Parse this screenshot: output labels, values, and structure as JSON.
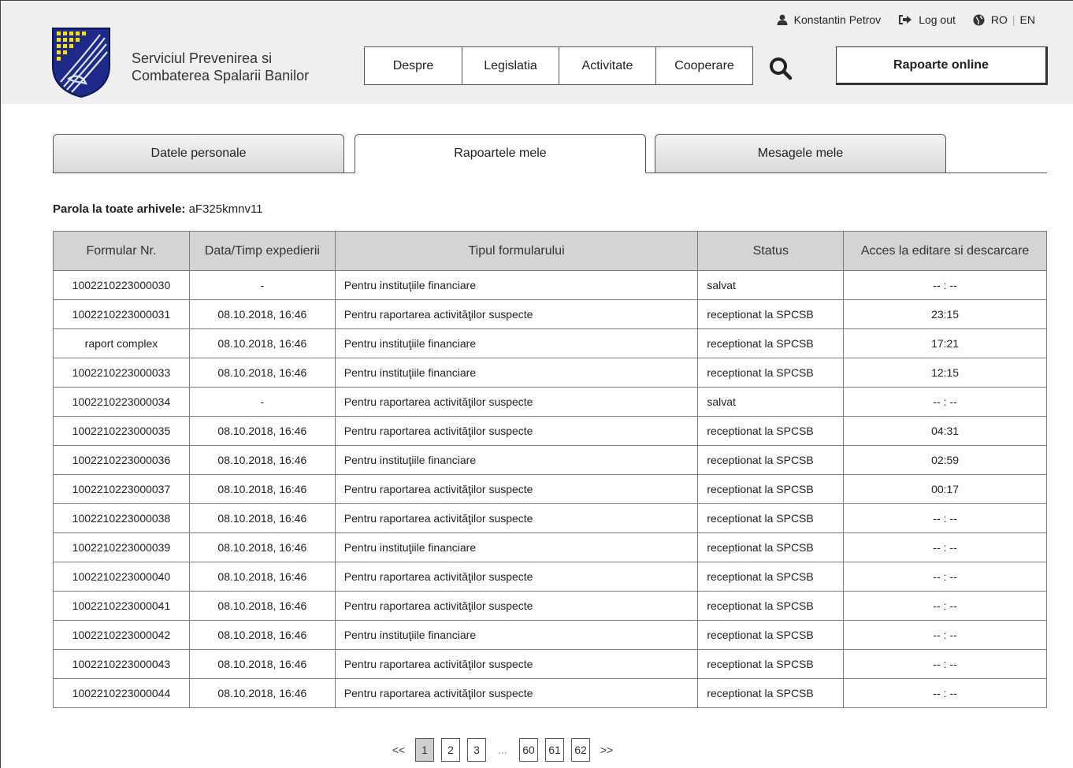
{
  "header": {
    "org_line1": "Serviciul Prevenirea si",
    "org_line2": "Combaterea Spalarii Banilor",
    "user_name": "Konstantin Petrov",
    "logout_label": "Log out",
    "lang_ro": "RO",
    "lang_sep": "|",
    "lang_en": "EN",
    "nav": [
      "Despre",
      "Legislatia",
      "Activitate",
      "Cooperare"
    ],
    "rapoarte_label": "Rapoarte online",
    "icons": {
      "user": "user-icon",
      "logout": "logout-icon",
      "globe": "globe-icon",
      "search": "search-icon"
    }
  },
  "tabs": [
    "Datele personale",
    "Rapoartele mele",
    "Mesagele mele"
  ],
  "active_tab": 1,
  "password": {
    "label": "Parola la toate arhivele:",
    "value": "aF325kmnv11"
  },
  "table": {
    "headers": [
      "Formular Nr.",
      "Data/Timp expedierii",
      "Tipul formularului",
      "Status",
      "Acces la editare si descarcare"
    ],
    "rows": [
      [
        "1002210223000030",
        "-",
        "Pentru instituţiile financiare",
        "salvat",
        "-- : --"
      ],
      [
        "1002210223000031",
        "08.10.2018, 16:46",
        "Pentru raportarea activităţilor suspecte",
        "receptionat la SPCSB",
        "23:15"
      ],
      [
        "raport complex",
        "08.10.2018, 16:46",
        "Pentru instituţiile financiare",
        "receptionat la SPCSB",
        "17:21"
      ],
      [
        "1002210223000033",
        "08.10.2018, 16:46",
        "Pentru instituţiile financiare",
        "receptionat la SPCSB",
        "12:15"
      ],
      [
        "1002210223000034",
        "-",
        "Pentru raportarea activităţilor suspecte",
        "salvat",
        "-- : --"
      ],
      [
        "1002210223000035",
        "08.10.2018, 16:46",
        "Pentru raportarea activităţilor suspecte",
        "receptionat la SPCSB",
        "04:31"
      ],
      [
        "1002210223000036",
        "08.10.2018, 16:46",
        "Pentru instituţiile financiare",
        "receptionat la SPCSB",
        "02:59"
      ],
      [
        "1002210223000037",
        "08.10.2018, 16:46",
        "Pentru raportarea activităţilor suspecte",
        "receptionat la SPCSB",
        "00:17"
      ],
      [
        "1002210223000038",
        "08.10.2018, 16:46",
        "Pentru raportarea activităţilor suspecte",
        "receptionat la SPCSB",
        "-- : --"
      ],
      [
        "1002210223000039",
        "08.10.2018, 16:46",
        "Pentru instituţiile financiare",
        "receptionat la SPCSB",
        "-- : --"
      ],
      [
        "1002210223000040",
        "08.10.2018, 16:46",
        "Pentru raportarea activităţilor suspecte",
        "receptionat la SPCSB",
        "-- : --"
      ],
      [
        "1002210223000041",
        "08.10.2018, 16:46",
        "Pentru raportarea activităţilor suspecte",
        "receptionat la SPCSB",
        "-- : --"
      ],
      [
        "1002210223000042",
        "08.10.2018, 16:46",
        "Pentru instituţiile financiare",
        "receptionat la SPCSB",
        "-- : --"
      ],
      [
        "1002210223000043",
        "08.10.2018, 16:46",
        "Pentru raportarea activităţilor suspecte",
        "receptionat la SPCSB",
        "-- : --"
      ],
      [
        "1002210223000044",
        "08.10.2018, 16:46",
        "Pentru raportarea activităţilor suspecte",
        "receptionat la SPCSB",
        "-- : --"
      ]
    ]
  },
  "pagination": {
    "prev": "<<",
    "pages_start": [
      "1",
      "2",
      "3"
    ],
    "ellipsis": "...",
    "pages_end": [
      "60",
      "61",
      "62"
    ],
    "next": ">>",
    "current": "1"
  }
}
